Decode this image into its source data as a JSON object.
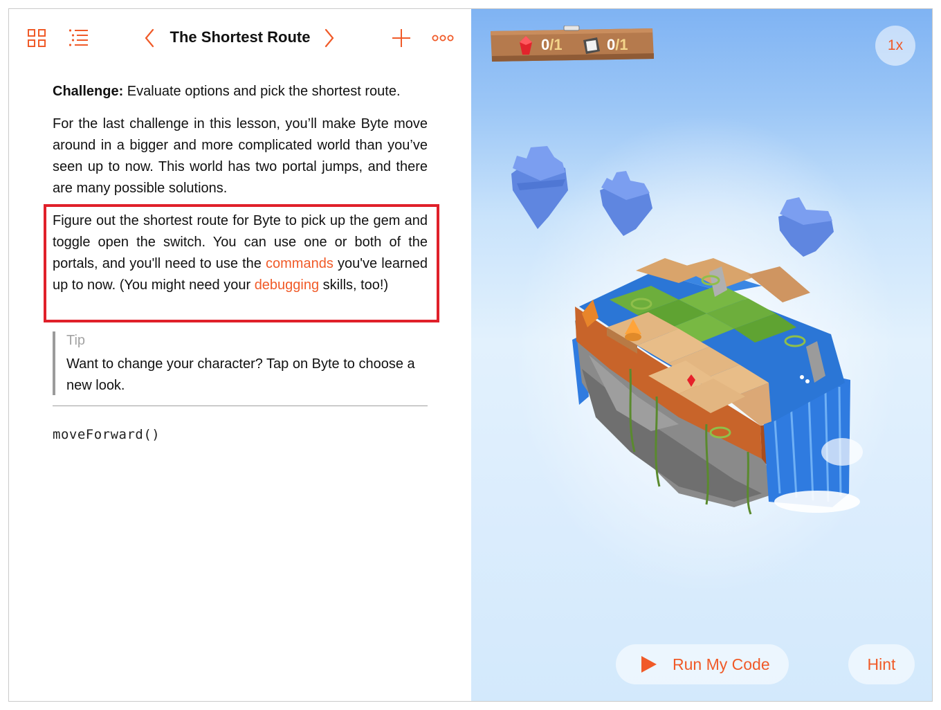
{
  "toolbar": {
    "title": "The Shortest Route",
    "icons": [
      "grid-icon",
      "list-icon",
      "chevron-left-icon",
      "chevron-right-icon",
      "plus-icon",
      "more-icon"
    ]
  },
  "document": {
    "challenge_label": "Challenge:",
    "challenge_text": " Evaluate options and pick the shortest route.",
    "intro": "For the last challenge in this lesson, you’ll make Byte move around in a bigger and more complicated world than you’ve seen up to now. This world has two portal jumps, and there are many possible solutions.",
    "task_part1": "Figure out the shortest route for Byte to pick up the gem and toggle open the switch. You can use one or both of the portals, and you'll need to use the ",
    "task_link1": "commands",
    "task_part2": " you've learned up to now. (You might need your ",
    "task_link2": "debugging",
    "task_part3": " skills, too!)",
    "tip_label": "Tip",
    "tip_body": "Want to change your character? Tap on Byte to choose a new look."
  },
  "code": {
    "line1": "moveForward()"
  },
  "game": {
    "gems_collected": "0",
    "gems_total": "/1",
    "switches_toggled": "0",
    "switches_total": "/1",
    "speed_label": "1x",
    "run_label": "Run My Code",
    "hint_label": "Hint"
  },
  "colors": {
    "accent": "#f05a28",
    "highlight_box": "#e0202a",
    "sky_top": "#7fb3f3",
    "sky_bottom": "#d3e9fc"
  }
}
